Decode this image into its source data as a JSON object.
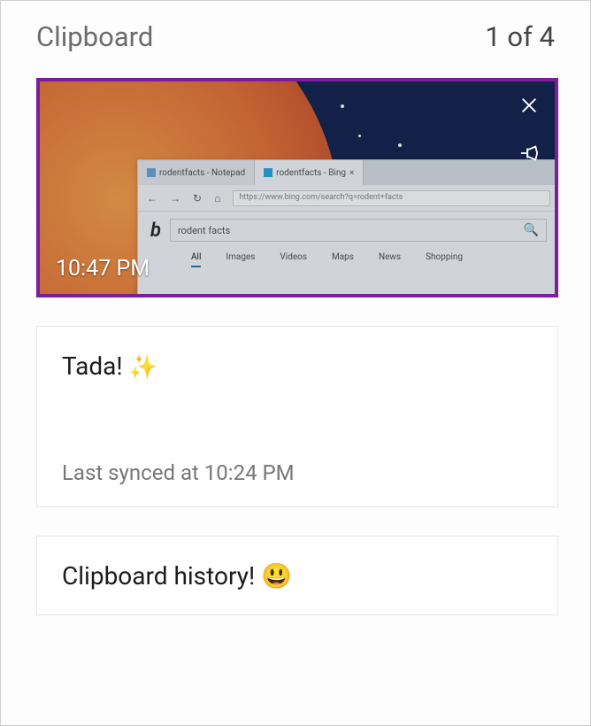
{
  "header": {
    "title": "Clipboard",
    "counter": "1 of 4"
  },
  "items": [
    {
      "kind": "image",
      "timestamp": "10:47 PM",
      "thumb": {
        "tab1": "rodentfacts - Notepad",
        "tab2": "rodentfacts - Bing",
        "url": "https://www.bing.com/search?q=rodent+facts",
        "search_query": "rodent facts",
        "nav": [
          "All",
          "Images",
          "Videos",
          "Maps",
          "News",
          "Shopping"
        ]
      },
      "actions": {
        "close_label": "Delete",
        "pin_label": "Pin"
      }
    },
    {
      "kind": "text",
      "content": "Tada! ",
      "emoji": "✨",
      "meta": "Last synced at 10:24 PM"
    },
    {
      "kind": "text",
      "content": "Clipboard history! ",
      "emoji": "😃"
    }
  ]
}
